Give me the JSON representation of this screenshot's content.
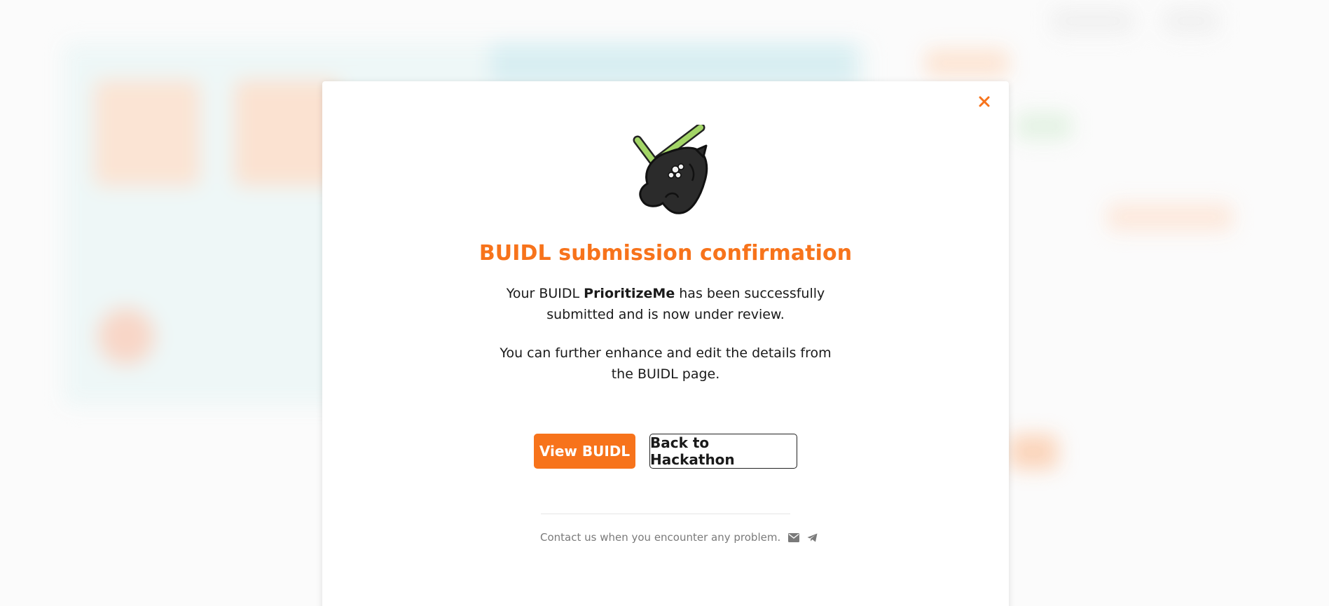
{
  "modal": {
    "title": "BUIDL submission confirmation",
    "message1_before": "Your BUIDL ",
    "buidl_name": "PrioritizeMe",
    "message1_after": " has been successfully submitted and is now under review.",
    "message2": "You can further enhance and edit the details from the BUIDL page.",
    "primary_button": "View BUIDL",
    "secondary_button": "Back to Hackathon",
    "contact_text": "Contact us when you encounter any problem."
  },
  "icons": {
    "close": "close-icon",
    "mascot": "success-mascot-icon",
    "email": "email-icon",
    "telegram": "telegram-icon"
  },
  "colors": {
    "accent": "#f7731b",
    "checkmark": "#a3d567",
    "text": "#1a1a1a",
    "muted": "#7a7a7a"
  }
}
